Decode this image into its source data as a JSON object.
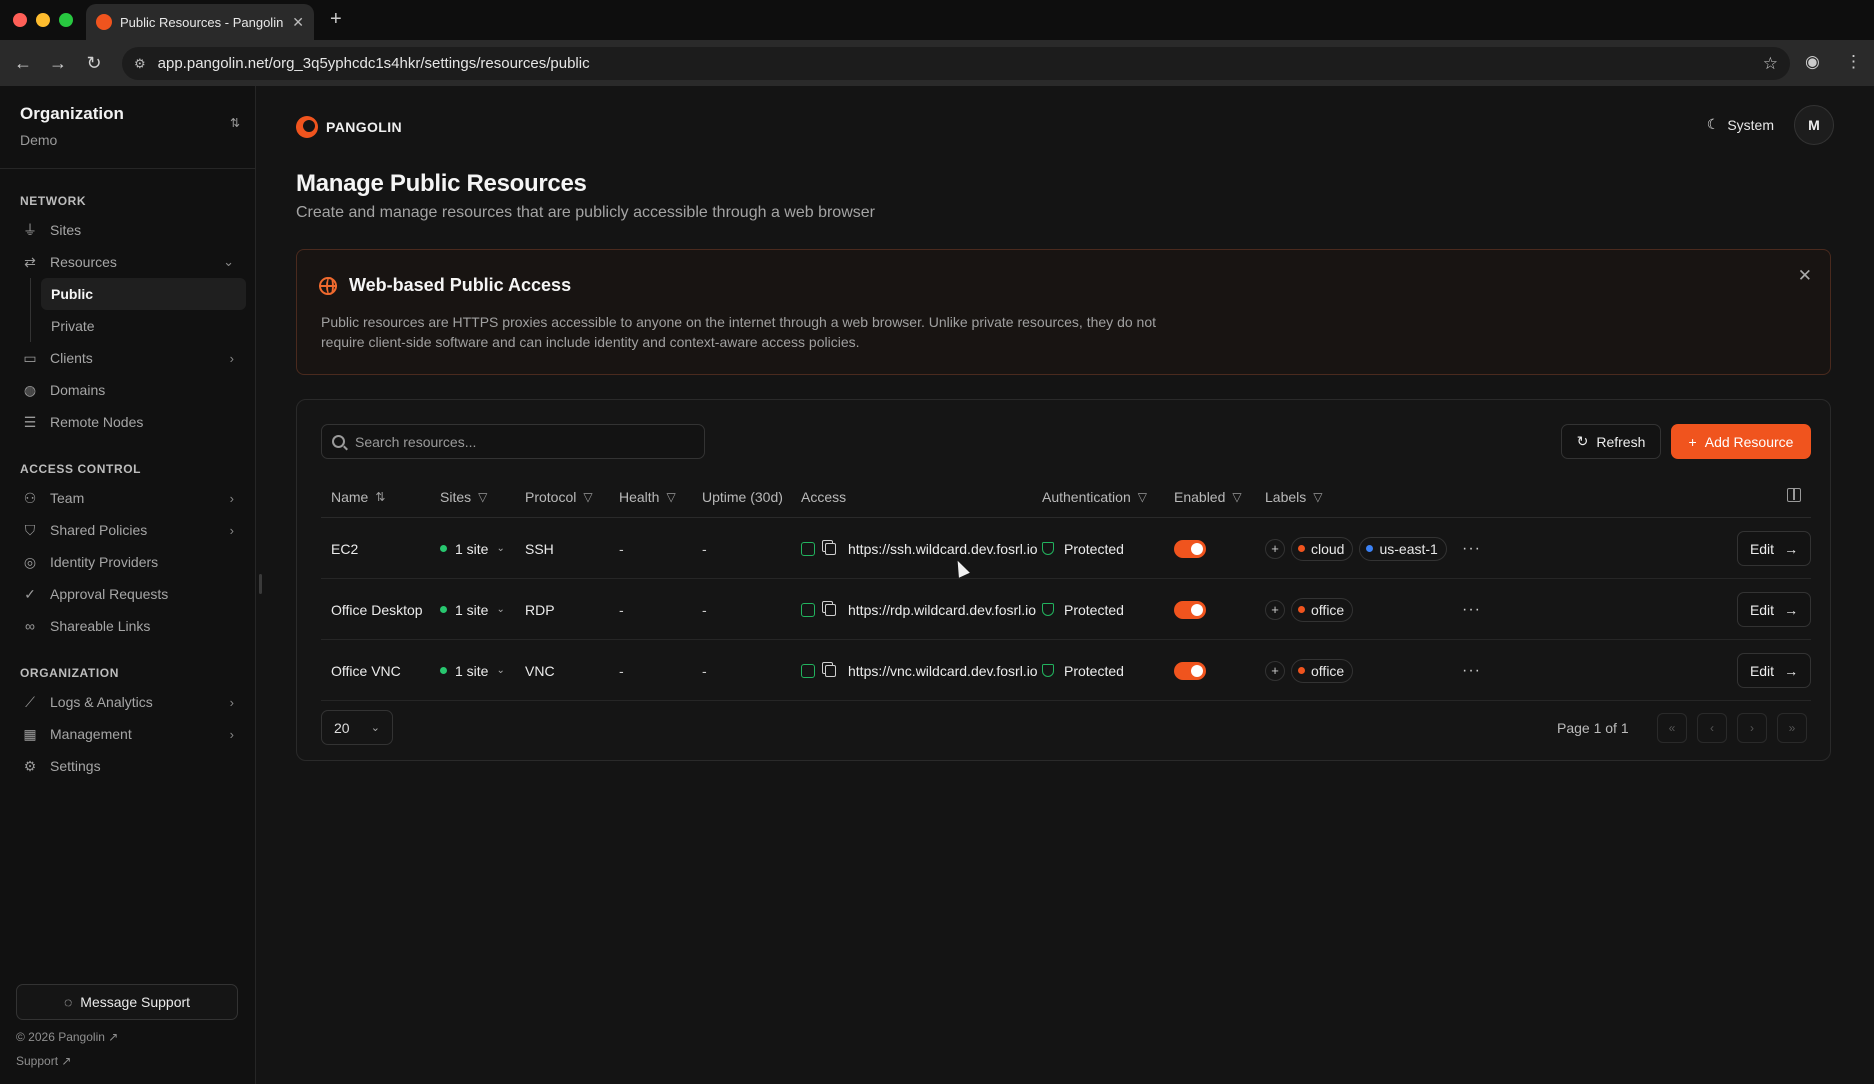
{
  "browser": {
    "tab_title": "Public Resources - Pangolin",
    "url": "app.pangolin.net/org_3q5yphcdc1s4hkr/settings/resources/public"
  },
  "sidebar": {
    "org_label": "Organization",
    "org_name": "Demo",
    "sections": [
      {
        "heading": "NETWORK",
        "items": [
          {
            "label": "Sites",
            "icon": "plug-icon"
          },
          {
            "label": "Resources",
            "icon": "arrows-icon",
            "expanded": true,
            "sub": [
              "Public",
              "Private"
            ],
            "active_sub": "Public"
          },
          {
            "label": "Clients",
            "icon": "monitor-icon",
            "chevron": true
          },
          {
            "label": "Domains",
            "icon": "globe-icon"
          },
          {
            "label": "Remote Nodes",
            "icon": "server-icon"
          }
        ]
      },
      {
        "heading": "ACCESS CONTROL",
        "items": [
          {
            "label": "Team",
            "icon": "users-icon",
            "chevron": true
          },
          {
            "label": "Shared Policies",
            "icon": "shield-icon",
            "chevron": true
          },
          {
            "label": "Identity Providers",
            "icon": "fingerprint-icon"
          },
          {
            "label": "Approval Requests",
            "icon": "user-check-icon"
          },
          {
            "label": "Shareable Links",
            "icon": "link-icon"
          }
        ]
      },
      {
        "heading": "ORGANIZATION",
        "items": [
          {
            "label": "Logs & Analytics",
            "icon": "chart-icon",
            "chevron": true
          },
          {
            "label": "Management",
            "icon": "building-icon",
            "chevron": true
          },
          {
            "label": "Settings",
            "icon": "gear-icon"
          }
        ]
      }
    ],
    "message_support": "Message Support",
    "copyright": "© 2026 Pangolin",
    "support": "Support"
  },
  "header": {
    "brand": "PANGOLIN",
    "theme": "System",
    "avatar_initial": "M"
  },
  "page": {
    "title": "Manage Public Resources",
    "subtitle": "Create and manage resources that are publicly accessible through a web browser"
  },
  "callout": {
    "title": "Web-based Public Access",
    "body": "Public resources are HTTPS proxies accessible to anyone on the internet through a web browser. Unlike private resources, they do not require client-side software and can include identity and context-aware access policies."
  },
  "table": {
    "search_placeholder": "Search resources...",
    "refresh_label": "Refresh",
    "add_label": "Add Resource",
    "columns": {
      "name": "Name",
      "sites": "Sites",
      "protocol": "Protocol",
      "health": "Health",
      "uptime": "Uptime (30d)",
      "access": "Access",
      "authentication": "Authentication",
      "enabled": "Enabled",
      "labels": "Labels"
    },
    "rows": [
      {
        "name": "EC2",
        "sites": "1 site",
        "protocol": "SSH",
        "health": "-",
        "uptime": "-",
        "access": "https://ssh.wildcard.dev.fosrl.io",
        "auth": "Protected",
        "enabled": true,
        "labels": [
          {
            "text": "cloud",
            "color": "#f0541e"
          },
          {
            "text": "us-east-1",
            "color": "#3b82f6"
          }
        ],
        "edit": "Edit"
      },
      {
        "name": "Office Desktop",
        "sites": "1 site",
        "protocol": "RDP",
        "health": "-",
        "uptime": "-",
        "access": "https://rdp.wildcard.dev.fosrl.io",
        "auth": "Protected",
        "enabled": true,
        "labels": [
          {
            "text": "office",
            "color": "#f0541e"
          }
        ],
        "edit": "Edit"
      },
      {
        "name": "Office VNC",
        "sites": "1 site",
        "protocol": "VNC",
        "health": "-",
        "uptime": "-",
        "access": "https://vnc.wildcard.dev.fosrl.io",
        "auth": "Protected",
        "enabled": true,
        "labels": [
          {
            "text": "office",
            "color": "#f0541e"
          }
        ],
        "edit": "Edit"
      }
    ],
    "page_size": "20",
    "page_info": "Page 1 of 1"
  },
  "colors": {
    "accent": "#f0541e",
    "success": "#28c76f",
    "background": "#141414"
  }
}
